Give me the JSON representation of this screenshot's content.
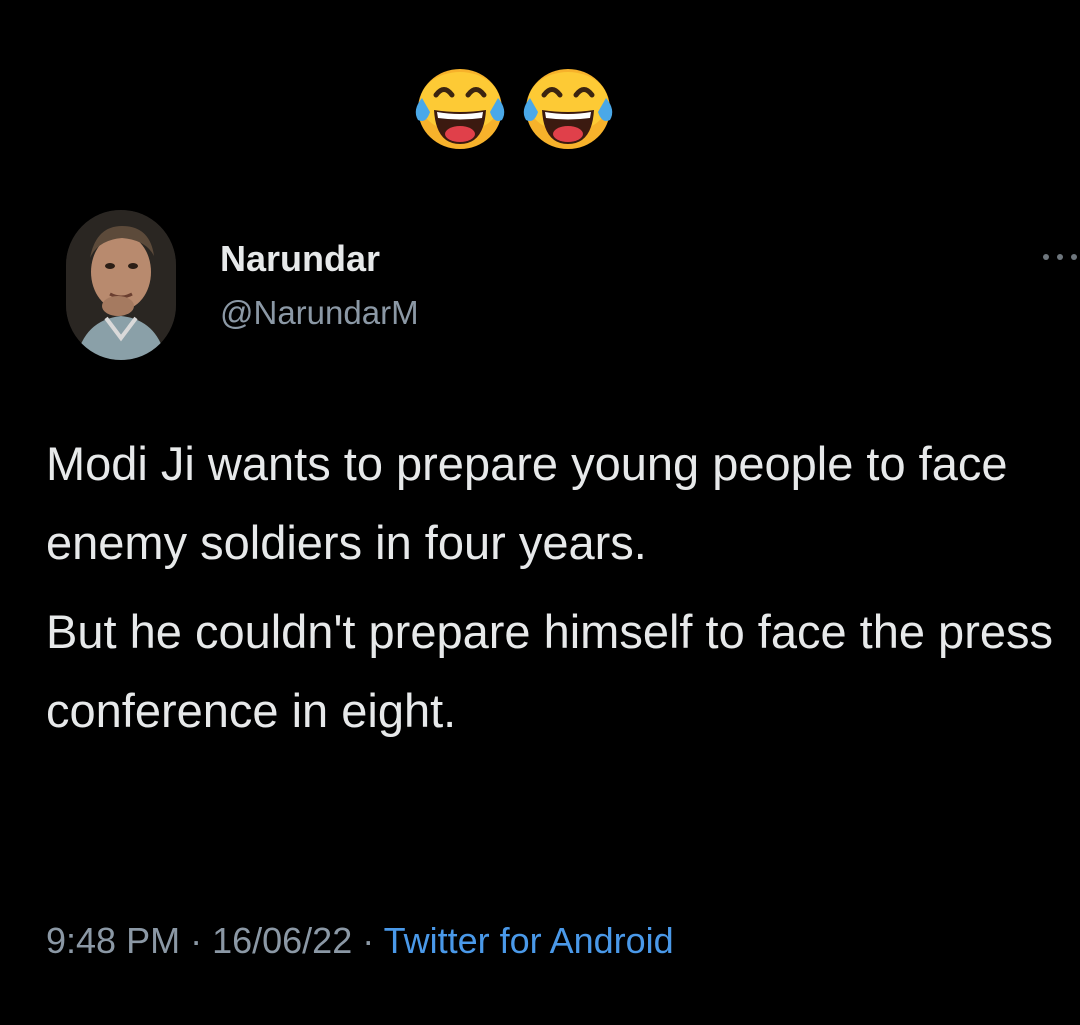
{
  "reaction": {
    "icon": "face-with-tears-of-joy-icon",
    "count_shown": 2
  },
  "tweet": {
    "author": {
      "display_name": "Narundar",
      "handle": "@NarundarM"
    },
    "more_icon": "more-horizontal-icon",
    "text": {
      "paragraph_1": "Modi Ji wants to prepare young people to face enemy soldiers in four years.",
      "paragraph_2": "But he couldn't prepare himself to face the press conference in eight."
    },
    "meta": {
      "time": "9:48 PM",
      "separator": " · ",
      "date": "16/06/22",
      "source": "Twitter for Android"
    }
  },
  "colors": {
    "background": "#000000",
    "primary_text": "#e7e9ea",
    "secondary_text": "#8b98a5",
    "link": "#4a99e9"
  }
}
